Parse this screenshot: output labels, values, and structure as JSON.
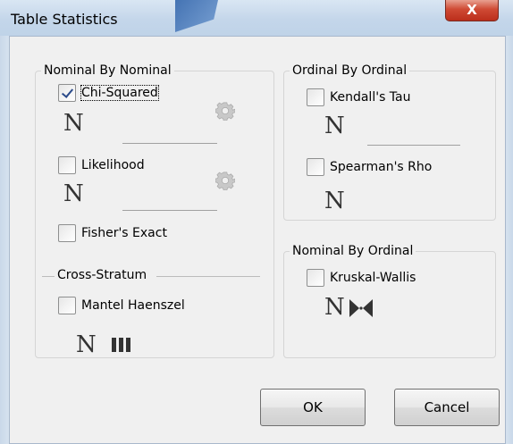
{
  "window": {
    "title": "Table Statistics",
    "close_label": "X"
  },
  "groups": {
    "nominal_by_nominal": {
      "legend": "Nominal By Nominal",
      "items": [
        {
          "label": "Chi-Squared",
          "checked": true
        },
        {
          "label": "Likelihood",
          "checked": false
        },
        {
          "label": "Fisher's Exact",
          "checked": false
        }
      ]
    },
    "cross_stratum": {
      "legend": "Cross-Stratum",
      "items": [
        {
          "label": "Mantel Haenszel",
          "checked": false
        }
      ]
    },
    "ordinal_by_ordinal": {
      "legend": "Ordinal By Ordinal",
      "items": [
        {
          "label": "Kendall's Tau",
          "checked": false
        },
        {
          "label": "Spearman's Rho",
          "checked": false
        }
      ]
    },
    "nominal_by_ordinal": {
      "legend": "Nominal By Ordinal",
      "items": [
        {
          "label": "Kruskal-Wallis",
          "checked": false
        }
      ]
    }
  },
  "icons": {
    "n_glyph": "N"
  },
  "buttons": {
    "ok": "OK",
    "cancel": "Cancel"
  }
}
